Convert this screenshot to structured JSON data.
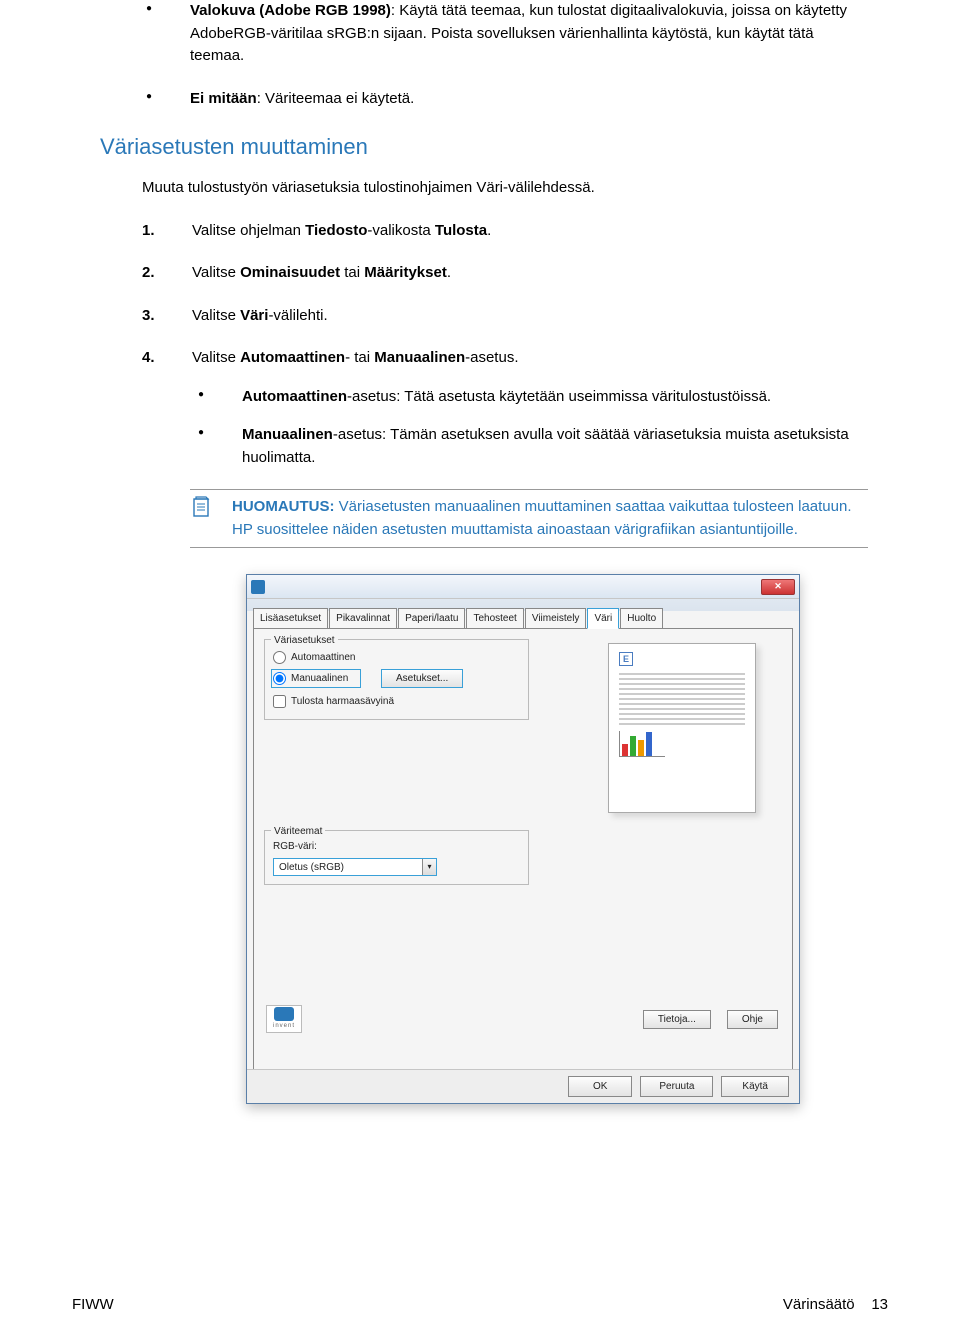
{
  "bullets": {
    "item1": {
      "title": "Valokuva (Adobe RGB 1998)",
      "text": ": Käytä tätä teemaa, kun tulostat digitaalivalokuvia, joissa on käytetty AdobeRGB-väritilaa sRGB:n sijaan. Poista sovelluksen värienhallinta käytöstä, kun käytät tätä teemaa."
    },
    "item2": {
      "title": "Ei mitään",
      "text": ": Väriteemaa ei käytetä."
    }
  },
  "heading": "Väriasetusten muuttaminen",
  "intro": "Muuta tulostustyön väriasetuksia tulostinohjaimen Väri-välilehdessä.",
  "steps": {
    "s1": {
      "num": "1.",
      "pre": "Valitse ohjelman ",
      "b1": "Tiedosto",
      "mid": "-valikosta ",
      "b2": "Tulosta",
      "post": "."
    },
    "s2": {
      "num": "2.",
      "pre": "Valitse ",
      "b1": "Ominaisuudet",
      "mid": " tai ",
      "b2": "Määritykset",
      "post": "."
    },
    "s3": {
      "num": "3.",
      "pre": "Valitse ",
      "b1": "Väri",
      "post": "-välilehti."
    },
    "s4": {
      "num": "4.",
      "pre": "Valitse ",
      "b1": "Automaattinen",
      "mid": "- tai ",
      "b2": "Manuaalinen",
      "post": "-asetus."
    }
  },
  "sub": {
    "a": {
      "b": "Automaattinen",
      "t": "-asetus: Tätä asetusta käytetään useimmissa väritulostustöissä."
    },
    "b": {
      "b": "Manuaalinen",
      "t": "-asetus: Tämän asetuksen avulla voit säätää väriasetuksia muista asetuksista huolimatta."
    }
  },
  "note": {
    "label": "HUOMAUTUS:",
    "text": "Väriasetusten manuaalinen muuttaminen saattaa vaikuttaa tulosteen laatuun. HP suosittelee näiden asetusten muuttamista ainoastaan värigrafiikan asiantuntijoille."
  },
  "dialog": {
    "title": "",
    "close": "✕",
    "tabs": {
      "t1": "Lisäasetukset",
      "t2": "Pikavalinnat",
      "t3": "Paperi/laatu",
      "t4": "Tehosteet",
      "t5": "Viimeistely",
      "t6": "Väri",
      "t7": "Huolto"
    },
    "group1": {
      "label": "Väriasetukset",
      "r1": "Automaattinen",
      "r2": "Manuaalinen",
      "btn": "Asetukset...",
      "chk": "Tulosta harmaasävyinä"
    },
    "group2": {
      "label": "Väriteemat",
      "l1": "RGB-väri:",
      "combo": "Oletus (sRGB)"
    },
    "midbtns": {
      "b1": "Tietoja...",
      "b2": "Ohje"
    },
    "bottom": {
      "ok": "OK",
      "cancel": "Peruuta",
      "apply": "Käytä"
    },
    "logo": "invent"
  },
  "footer": {
    "left": "FIWW",
    "right": "Värinsäätö",
    "page": "13"
  }
}
